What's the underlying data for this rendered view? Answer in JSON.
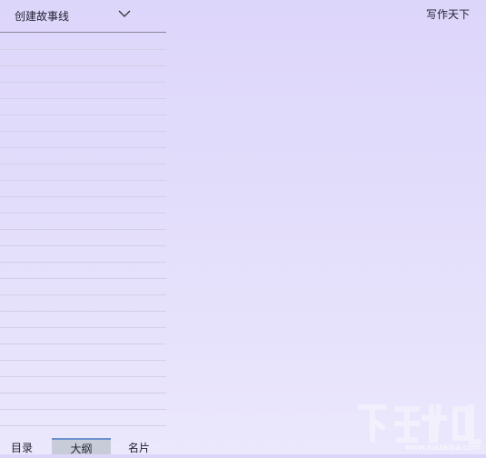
{
  "header": {
    "app_title": "写作天下"
  },
  "storyline_selector": {
    "label": "创建故事线"
  },
  "tabs": [
    {
      "label": "目录"
    },
    {
      "label": "大纲",
      "selected": true
    },
    {
      "label": "名片"
    }
  ],
  "watermark": {
    "url": "www.xiazaiba.com"
  }
}
